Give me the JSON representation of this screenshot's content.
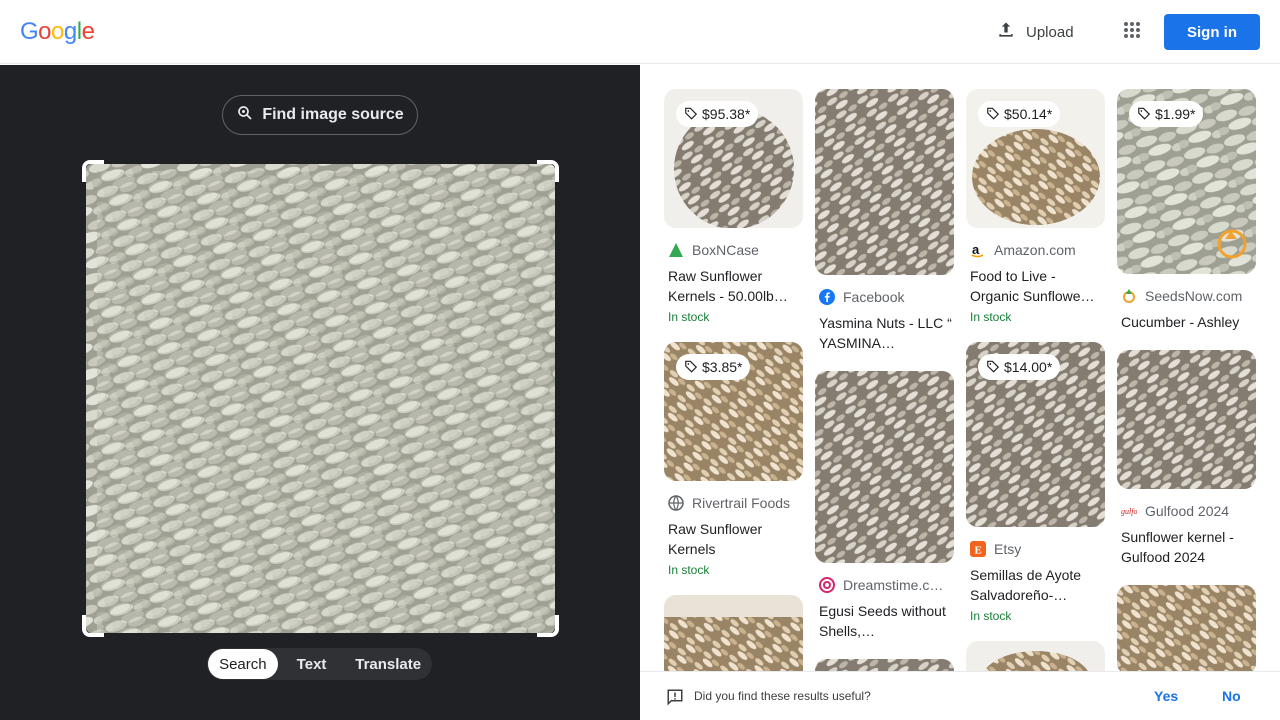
{
  "header": {
    "logo_letters": [
      "G",
      "o",
      "o",
      "g",
      "l",
      "e"
    ],
    "logo_colors": [
      "#4285f4",
      "#ea4335",
      "#fbbc05",
      "#4285f4",
      "#34a853",
      "#ea4335"
    ],
    "upload_label": "Upload",
    "signin_label": "Sign in"
  },
  "lens": {
    "find_source_label": "Find image source",
    "tabs": [
      "Search",
      "Text",
      "Translate"
    ],
    "active_tab": "Search"
  },
  "results": [
    {
      "price": "$95.38*",
      "source": "BoxNCase",
      "source_icon": "boxncase-icon",
      "title": "Raw Sunflower Kernels - 50.00lb…",
      "stock": "In stock"
    },
    {
      "price": "",
      "source": "Facebook",
      "source_icon": "facebook-icon",
      "title": "Yasmina Nuts - LLC “ YASMINA…",
      "stock": ""
    },
    {
      "price": "$50.14*",
      "source": "Amazon.com",
      "source_icon": "amazon-icon",
      "title": "Food to Live - Organic Sunflowe…",
      "stock": "In stock"
    },
    {
      "price": "$1.99*",
      "source": "SeedsNow.com",
      "source_icon": "seedsnow-icon",
      "title": "Cucumber - Ashley",
      "stock": ""
    },
    {
      "price": "$3.85*",
      "source": "Rivertrail Foods",
      "source_icon": "globe-icon",
      "title": "Raw Sunflower Kernels",
      "stock": "In stock"
    },
    {
      "price": "",
      "source": "Dreamstime.c…",
      "source_icon": "dreamstime-icon",
      "title": "Egusi Seeds without Shells,…",
      "stock": ""
    },
    {
      "price": "$14.00*",
      "source": "Etsy",
      "source_icon": "etsy-icon",
      "title": "Semillas de Ayote Salvadoreño-…",
      "stock": "In stock"
    },
    {
      "price": "",
      "source": "Gulfood 2024",
      "source_icon": "gulfood-icon",
      "title": "Sunflower kernel - Gulfood 2024",
      "stock": ""
    }
  ],
  "feedback": {
    "question": "Did you find these results useful?",
    "yes_label": "Yes",
    "no_label": "No"
  },
  "colors": {
    "accent": "#1a73e8",
    "dark_panel": "#202124",
    "in_stock": "#188038"
  }
}
